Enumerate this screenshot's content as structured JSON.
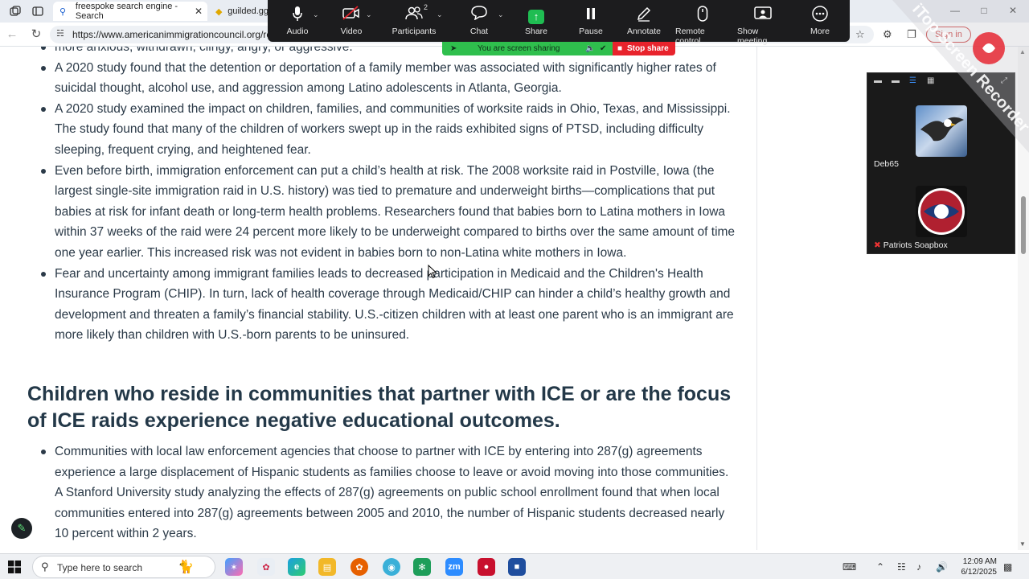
{
  "browser": {
    "tabs": [
      {
        "label": "freespoke search engine - Search"
      },
      {
        "label": "guilded.gg"
      }
    ],
    "url": "https://www.americanimmigrationcouncil.org/res",
    "sign_in_label": "Sign in"
  },
  "zoom": {
    "toolbar": [
      {
        "label": "Audio",
        "icon": "microphone-icon"
      },
      {
        "label": "Video",
        "icon": "video-off-icon"
      },
      {
        "label": "Participants",
        "icon": "participants-icon",
        "count": "2"
      },
      {
        "label": "Chat",
        "icon": "chat-icon"
      },
      {
        "label": "Share",
        "icon": "share-icon"
      },
      {
        "label": "Pause",
        "icon": "pause-icon"
      },
      {
        "label": "Annotate",
        "icon": "pencil-icon"
      },
      {
        "label": "Remote control",
        "icon": "mouse-icon"
      },
      {
        "label": "Show meeting",
        "icon": "monitor-icon"
      },
      {
        "label": "More",
        "icon": "more-icon"
      }
    ],
    "sharing_status": "You are screen sharing",
    "stop_share_label": "Stop share",
    "participants": [
      {
        "name": "Deb65"
      },
      {
        "name": "Patriots Soapbox"
      }
    ]
  },
  "watermark": "iTop Screen Recorder",
  "article": {
    "partial_top": "more anxious, withdrawn, clingy, angry, or aggressive.",
    "bullets1": [
      "A 2020 study found that the detention or deportation of a family member was associated with significantly higher rates of suicidal thought, alcohol use, and aggression among Latino adolescents in Atlanta, Georgia.",
      "A 2020 study examined the impact on children, families, and communities of worksite raids in Ohio, Texas, and Mississippi. The study found that many of the children of workers swept up in the raids exhibited signs of PTSD, including difficulty sleeping, frequent crying, and heightened fear.",
      "Even before birth, immigration enforcement can put a child’s health at risk. The 2008 worksite raid in Postville, Iowa (the largest single-site immigration raid in U.S. history) was tied to premature and underweight births—complications that put babies at risk for infant death or long-term health problems. Researchers found that babies born to Latina mothers in Iowa within 37 weeks of the raid were 24 percent more likely to be underweight compared to births over the same amount of time one year earlier. This increased risk was not evident in babies born to non-Latina white mothers in Iowa.",
      "Fear and uncertainty among immigrant families leads to decreased participation in Medicaid and the Children's Health Insurance Program (CHIP). In turn, lack of health coverage through Medicaid/CHIP can hinder a child’s healthy growth and development and threaten a family’s financial stability. U.S.-citizen children with at least one parent who is an immigrant are more likely than children with U.S.-born parents to be uninsured."
    ],
    "heading": "Children who reside in communities that partner with ICE or are the focus of ICE raids experience negative educational outcomes.",
    "bullets2": [
      "Communities with local law enforcement agencies that choose to partner with ICE by entering into 287(g) agreements experience a large displacement of Hispanic students as families choose to leave or avoid moving into those communities. A Stanford University study analyzing the effects of 287(g) agreements on public school enrollment found that when local communities entered into 287(g) agreements between 2005 and 2010, the number of Hispanic students decreased nearly 10 percent within 2 years."
    ]
  },
  "taskbar": {
    "search_placeholder": "Type here to search",
    "time": "12:09 AM",
    "date": "6/12/2025"
  },
  "colors": {
    "zoom_bg": "#1c1c1e",
    "share_green": "#1fbd52",
    "stop_red": "#e8232c",
    "text": "#2b3a48",
    "heading": "#233848"
  }
}
